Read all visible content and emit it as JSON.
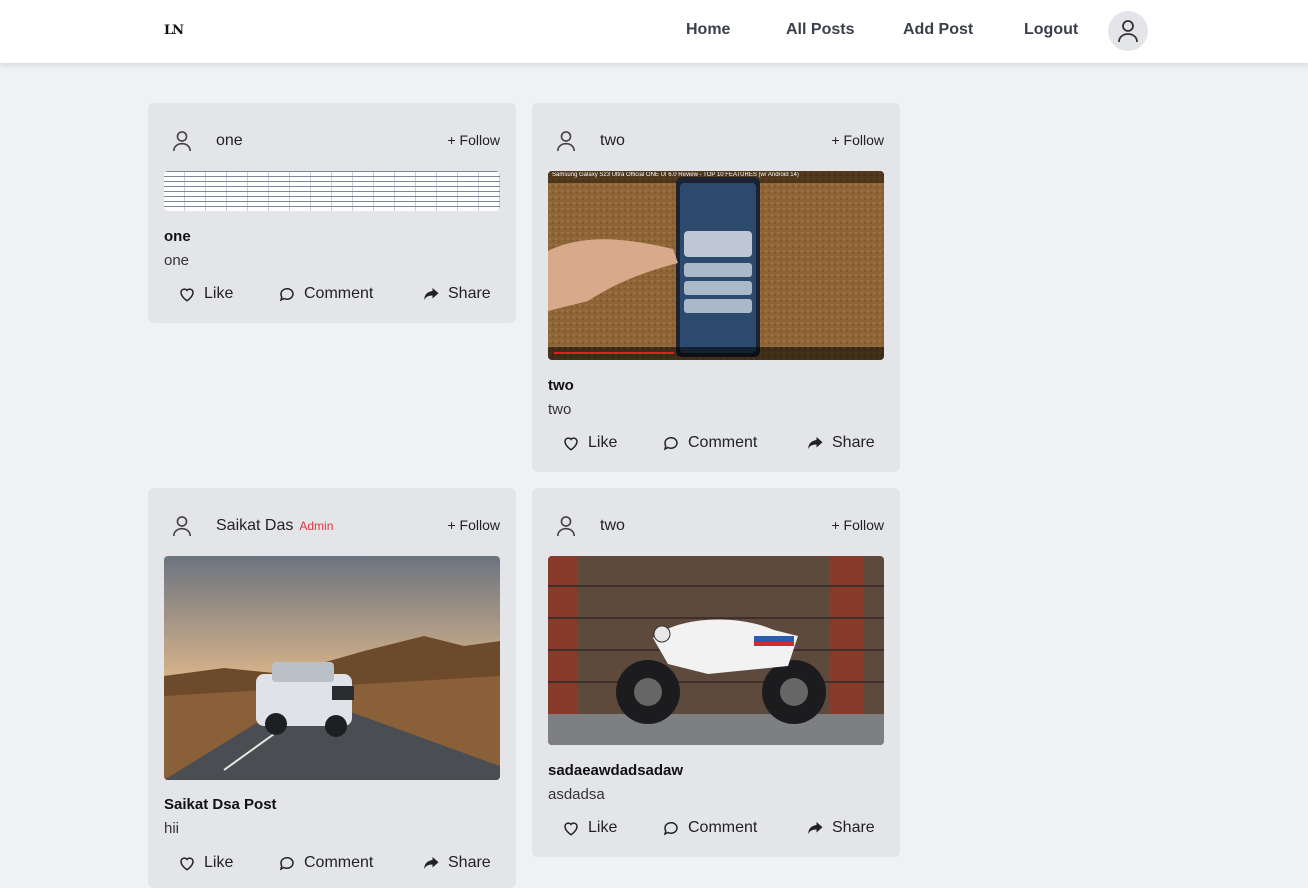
{
  "navbar": {
    "logo": "LN",
    "links": [
      "Home",
      "All Posts",
      "Add Post",
      "Logout"
    ]
  },
  "posts": [
    {
      "author": "one",
      "badge": "",
      "follow": "+ Follow",
      "title": "one",
      "body": "one",
      "media": "spreadsheet",
      "actions": {
        "like": "Like",
        "comment": "Comment",
        "share": "Share"
      }
    },
    {
      "author": "two",
      "badge": "",
      "follow": "+ Follow",
      "title": "two",
      "body": "two",
      "media": "video",
      "video_caption": "Samsung Galaxy S23 Ultra Official ONE UI 6.0 Review - TOP 10 FEATURES (w/ Android 14)",
      "actions": {
        "like": "Like",
        "comment": "Comment",
        "share": "Share"
      }
    },
    {
      "author": "Saikat Das",
      "badge": "Admin",
      "follow": "+ Follow",
      "title": "Saikat Dsa Post",
      "body": "hii",
      "media": "car-photo",
      "actions": {
        "like": "Like",
        "comment": "Comment",
        "share": "Share"
      }
    },
    {
      "author": "two",
      "badge": "",
      "follow": "+ Follow",
      "title": "sadaeawdadsadaw",
      "body": "asdadsa",
      "media": "motorcycle-photo",
      "actions": {
        "like": "Like",
        "comment": "Comment",
        "share": "Share"
      }
    }
  ],
  "colors": {
    "page_bg": "#eff1f5",
    "card_bg": "#e4e5e9",
    "admin_badge": "#d9373a"
  }
}
